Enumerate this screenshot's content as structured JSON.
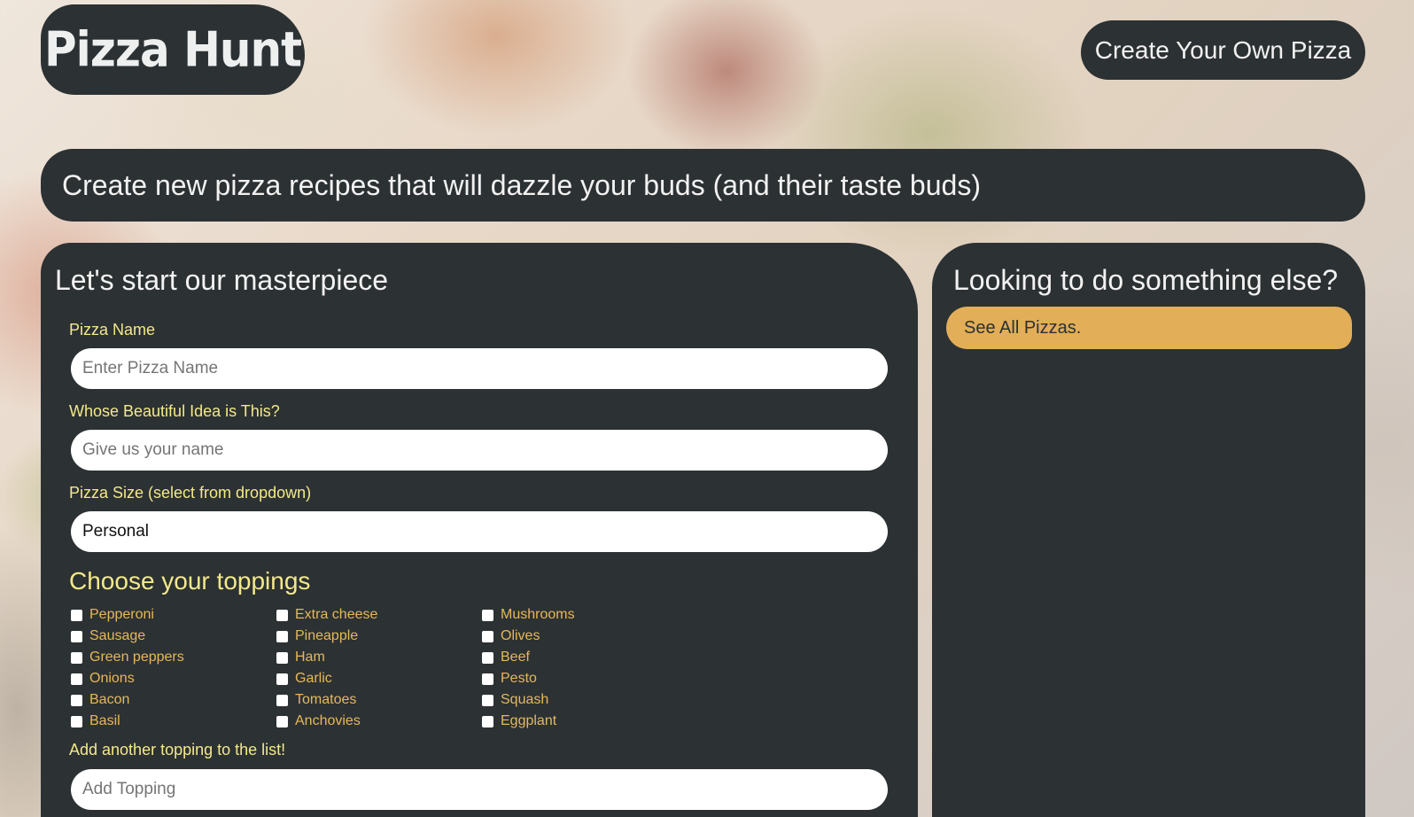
{
  "header": {
    "logo_text": "Pizza Hunt",
    "nav_button": "Create Your Own Pizza"
  },
  "hero": {
    "text": "Create new pizza recipes that will dazzle your buds (and their taste buds)"
  },
  "form": {
    "title": "Let's start our masterpiece",
    "pizza_name_label": "Pizza Name",
    "pizza_name_placeholder": "Enter Pizza Name",
    "creator_label": "Whose Beautiful Idea is This?",
    "creator_placeholder": "Give us your name",
    "size_label": "Pizza Size (select from dropdown)",
    "size_selected": "Personal",
    "toppings_title": "Choose your toppings",
    "toppings": [
      [
        "Pepperoni",
        "Sausage",
        "Green peppers",
        "Onions",
        "Bacon",
        "Basil"
      ],
      [
        "Extra cheese",
        "Pineapple",
        "Ham",
        "Garlic",
        "Tomatoes",
        "Anchovies"
      ],
      [
        "Mushrooms",
        "Olives",
        "Beef",
        "Pesto",
        "Squash",
        "Eggplant"
      ]
    ],
    "add_topping_label": "Add another topping to the list!",
    "add_topping_placeholder": "Add Topping"
  },
  "sidebar": {
    "title": "Looking to do something else?",
    "button": "See All Pizzas."
  },
  "colors": {
    "panel": "#2c3133",
    "label_yellow": "#f3e98a",
    "topping_orange": "#e6b85a",
    "accent_button": "#e2ae57"
  }
}
